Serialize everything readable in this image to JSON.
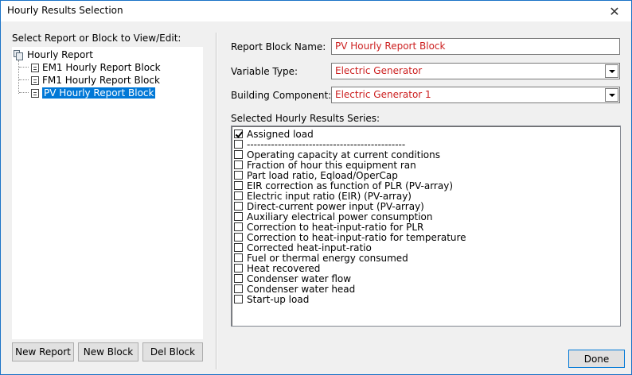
{
  "window": {
    "title": "Hourly Results Selection",
    "close_glyph": "✕"
  },
  "left_panel": {
    "label": "Select Report or Block to View/Edit:",
    "tree": {
      "root": "Hourly Report",
      "children": [
        "EM1 Hourly Report Block",
        "FM1 Hourly Report Block",
        "PV Hourly Report Block"
      ],
      "selected_index": 2
    },
    "buttons": {
      "new_report": "New Report",
      "new_block": "New Block",
      "del_block": "Del Block"
    }
  },
  "right_panel": {
    "report_block_name": {
      "label": "Report Block Name:",
      "value": "PV Hourly Report Block"
    },
    "variable_type": {
      "label": "Variable Type:",
      "value": "Electric Generator"
    },
    "building_component": {
      "label": "Building Component:",
      "value": "Electric Generator 1"
    },
    "series_label": "Selected Hourly Results Series:",
    "series": [
      {
        "label": "Assigned load",
        "checked": true
      },
      {
        "label": "----------------------------------------------",
        "checked": false
      },
      {
        "label": "Operating capacity at current conditions",
        "checked": false
      },
      {
        "label": "Fraction of hour this equipment ran",
        "checked": false
      },
      {
        "label": "Part load ratio, Eqload/OperCap",
        "checked": false
      },
      {
        "label": "EIR correction as function of PLR (PV-array)",
        "checked": false
      },
      {
        "label": "Electric input ratio (EIR) (PV-array)",
        "checked": false
      },
      {
        "label": "Direct-current power input (PV-array)",
        "checked": false
      },
      {
        "label": "Auxiliary electrical power consumption",
        "checked": false
      },
      {
        "label": "Correction to heat-input-ratio for PLR",
        "checked": false
      },
      {
        "label": "Correction to heat-input-ratio for temperature",
        "checked": false
      },
      {
        "label": "Corrected heat-input-ratio",
        "checked": false
      },
      {
        "label": "Fuel or thermal energy consumed",
        "checked": false
      },
      {
        "label": "Heat recovered",
        "checked": false
      },
      {
        "label": "Condenser water flow",
        "checked": false
      },
      {
        "label": "Condenser water head",
        "checked": false
      },
      {
        "label": "Start-up load",
        "checked": false
      }
    ],
    "done_label": "Done"
  },
  "colors": {
    "value_text": "#cc1f1f",
    "selection": "#0078d7",
    "window_border": "#1b73c7"
  }
}
